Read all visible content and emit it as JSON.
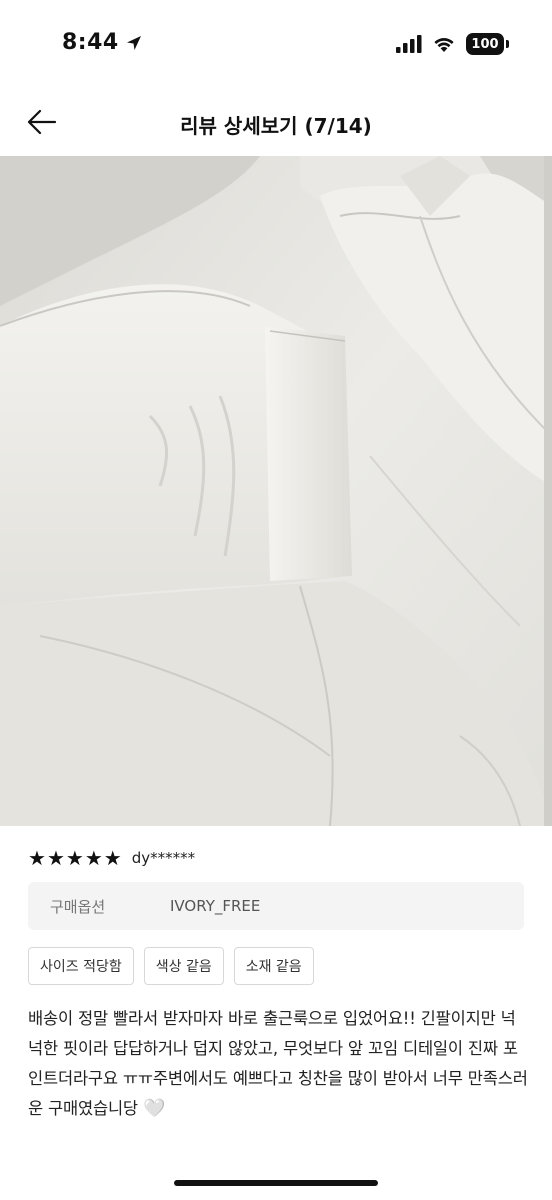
{
  "status_bar": {
    "time": "8:44",
    "battery": "100",
    "icons": [
      "location-arrow-icon",
      "cellular-signal-icon",
      "wifi-icon",
      "battery-icon"
    ]
  },
  "nav": {
    "back_icon": "arrow-left-icon",
    "title": "리뷰 상세보기 (7/14)"
  },
  "photo": {
    "description_icon": "review-photo"
  },
  "review": {
    "rating": 5,
    "stars": [
      "★",
      "★",
      "★",
      "★",
      "★"
    ],
    "reviewer": "dy******",
    "option_label": "구매옵션",
    "option_value": "IVORY_FREE",
    "tags": [
      "사이즈 적당함",
      "색상 같음",
      "소재 같음"
    ],
    "text": "배송이 정말 빨라서 받자마자 바로 출근룩으로 입었어요!! 긴팔이지만 넉넉한 핏이라 답답하거나 덥지 않았고, 무엇보다 앞 꼬임 디테일이 진짜 포인트더라구요 ㅠㅠ주변에서도 예쁘다고 칭찬을 많이 받아서 너무 만족스러운 구매였습니당",
    "emoji": "🤍"
  }
}
